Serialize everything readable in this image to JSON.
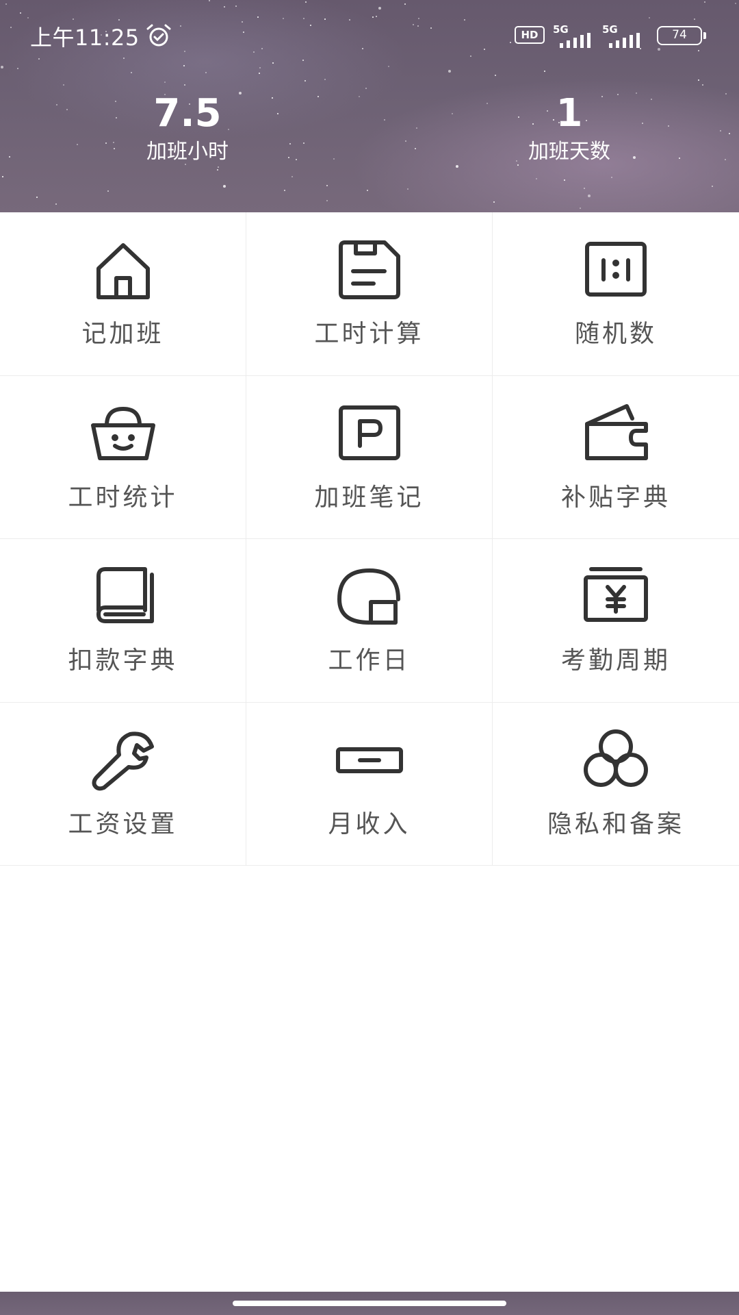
{
  "status_bar": {
    "time": "上午11:25",
    "hd_badge": "HD",
    "signal_1": "5G",
    "signal_2": "5G",
    "battery": "74"
  },
  "stats": {
    "hours_value": "7.5",
    "hours_label": "加班小时",
    "days_value": "1",
    "days_label": "加班天数"
  },
  "menu": {
    "items": [
      {
        "label": "记加班",
        "icon": "house-icon"
      },
      {
        "label": "工时计算",
        "icon": "floppy-disk-icon"
      },
      {
        "label": "随机数",
        "icon": "ratio-icon"
      },
      {
        "label": "工时统计",
        "icon": "basket-smile-icon"
      },
      {
        "label": "加班笔记",
        "icon": "parking-icon"
      },
      {
        "label": "补贴字典",
        "icon": "wallet-icon"
      },
      {
        "label": "扣款字典",
        "icon": "book-icon"
      },
      {
        "label": "工作日",
        "icon": "calendar-shape-icon"
      },
      {
        "label": "考勤周期",
        "icon": "yen-card-icon"
      },
      {
        "label": "工资设置",
        "icon": "wrench-icon"
      },
      {
        "label": "月收入",
        "icon": "minus-box-icon"
      },
      {
        "label": "隐私和备案",
        "icon": "circles-icon"
      }
    ]
  }
}
